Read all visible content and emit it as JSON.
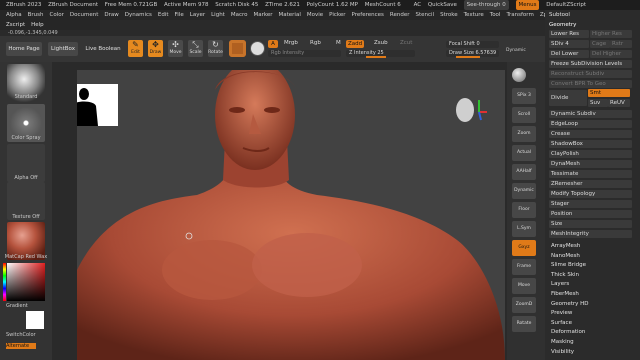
{
  "titlebar": {
    "app": "ZBrush 2023",
    "doc": "ZBrush Document",
    "free_mem": "Free Mem 0.721GB",
    "active_mem": "Active Mem 978",
    "scratch": "Scratch Disk 45",
    "ztime": "ZTime 2.621",
    "polycount": "PolyCount 1.62 MP",
    "meshcount": "MeshCount 6",
    "ac": "AC",
    "quicksave": "QuickSave",
    "see_through": "See-through",
    "see_through_value": "0",
    "menus": "Menus",
    "script": "DefaultZScript"
  },
  "menubar": [
    "Alpha",
    "Brush",
    "Color",
    "Document",
    "Draw",
    "Dynamics",
    "Edit",
    "File",
    "Layer",
    "Light",
    "Macro",
    "Marker",
    "Material",
    "Movie",
    "Picker",
    "Preferences",
    "Render",
    "Stencil",
    "Stroke",
    "Texture",
    "Tool",
    "Transform",
    "Zplugin"
  ],
  "menubar2": [
    "Zscript",
    "Help"
  ],
  "coords": "-0.096,-1.345,0.049",
  "toolbar": {
    "home": "Home Page",
    "lightbox": "LightBox",
    "live_boolean": "Live Boolean",
    "edit": "Edit",
    "draw": "Draw",
    "move": "Move",
    "scale": "Scale",
    "rotate": "Rotate",
    "a": "A",
    "mrgb": "Mrgb",
    "rgb": "Rgb",
    "m": "M",
    "zadd": "Zadd",
    "zsub": "Zsub",
    "zcut": "Zcut",
    "rgb_intensity": "Rgb Intensity",
    "z_intensity": "Z Intensity 25",
    "focal_shift": "Focal Shift 0",
    "draw_size": "Draw Size 6.57639",
    "dynamic": "Dynamic"
  },
  "lefttray": {
    "standard": "Standard",
    "color_spray": "Color Spray",
    "alpha_off": "Alpha Off",
    "texture_off": "Texture Off",
    "material": "MatCap Red Wax",
    "gradient": "Gradient",
    "switch_color": "SwitchColor",
    "alternate": "Alternate"
  },
  "shelf": [
    "SPix 3",
    "Scroll",
    "Zoom",
    "Actual",
    "AAHalf",
    "Dynamic Persp",
    "Floor",
    "L.Sym",
    "Gxyz",
    "Frame",
    "Move",
    "ZoomD",
    "Rotate"
  ],
  "panel": {
    "header": "Subtool",
    "geometry": "Geometry",
    "lower_res": "Lower Res",
    "higher_res": "Higher Res",
    "sdiv": "SDiv 4",
    "cage": "Cage",
    "rstr": "Rstr",
    "del_lower": "Del Lower",
    "del_higher": "Del Higher",
    "freeze": "Freeze SubDivision Levels",
    "reconstruct": "Reconstruct Subdiv",
    "convert": "Convert BPR To Geo",
    "divide": "Divide",
    "smt": "Smt",
    "suv": "Suv",
    "reuv": "ReUV",
    "items": [
      "Dynamic Subdiv",
      "EdgeLoop",
      "Crease",
      "ShadowBox",
      "ClayPolish",
      "DynaMesh",
      "Tessimate",
      "ZRemesher",
      "Modify Topology",
      "Stager",
      "Position",
      "Size",
      "MeshIntegrity"
    ],
    "subpanels": [
      "ArrayMesh",
      "NanoMesh",
      "Slime Bridge",
      "Thick Skin",
      "Layers",
      "FiberMesh",
      "Geometry HD",
      "Preview",
      "Surface",
      "Deformation",
      "Masking",
      "Visibility"
    ]
  },
  "colors": {
    "accent": "#e07a18",
    "skin": "#b5533d"
  }
}
